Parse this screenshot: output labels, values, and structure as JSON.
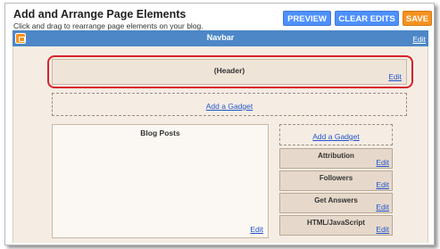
{
  "page": {
    "title": "Add and Arrange Page Elements",
    "subtitle": "Click and drag to rearrange page elements on your blog."
  },
  "toolbar": {
    "preview_label": "PREVIEW",
    "clear_label": "CLEAR EDITS",
    "save_label": "SAVE"
  },
  "navbar": {
    "label": "Navbar",
    "edit_label": "Edit",
    "icon": "blogger-icon"
  },
  "header": {
    "label": "(Header)",
    "edit_label": "Edit"
  },
  "add_gadget_label": "Add a Gadget",
  "blog_posts": {
    "label": "Blog Posts",
    "edit_label": "Edit"
  },
  "sidebar": {
    "add_gadget_label": "Add a Gadget",
    "gadgets": [
      {
        "label": "Attribution",
        "edit_label": "Edit"
      },
      {
        "label": "Followers",
        "edit_label": "Edit"
      },
      {
        "label": "Get Answers",
        "edit_label": "Edit"
      },
      {
        "label": "HTML/JavaScript",
        "edit_label": "Edit"
      }
    ]
  },
  "colors": {
    "button_blue": "#4d90fe",
    "button_orange": "#f6921e",
    "navbar_blue": "#4d87c8",
    "highlight_red": "#d6232a",
    "layout_background": "#f5ede4"
  }
}
